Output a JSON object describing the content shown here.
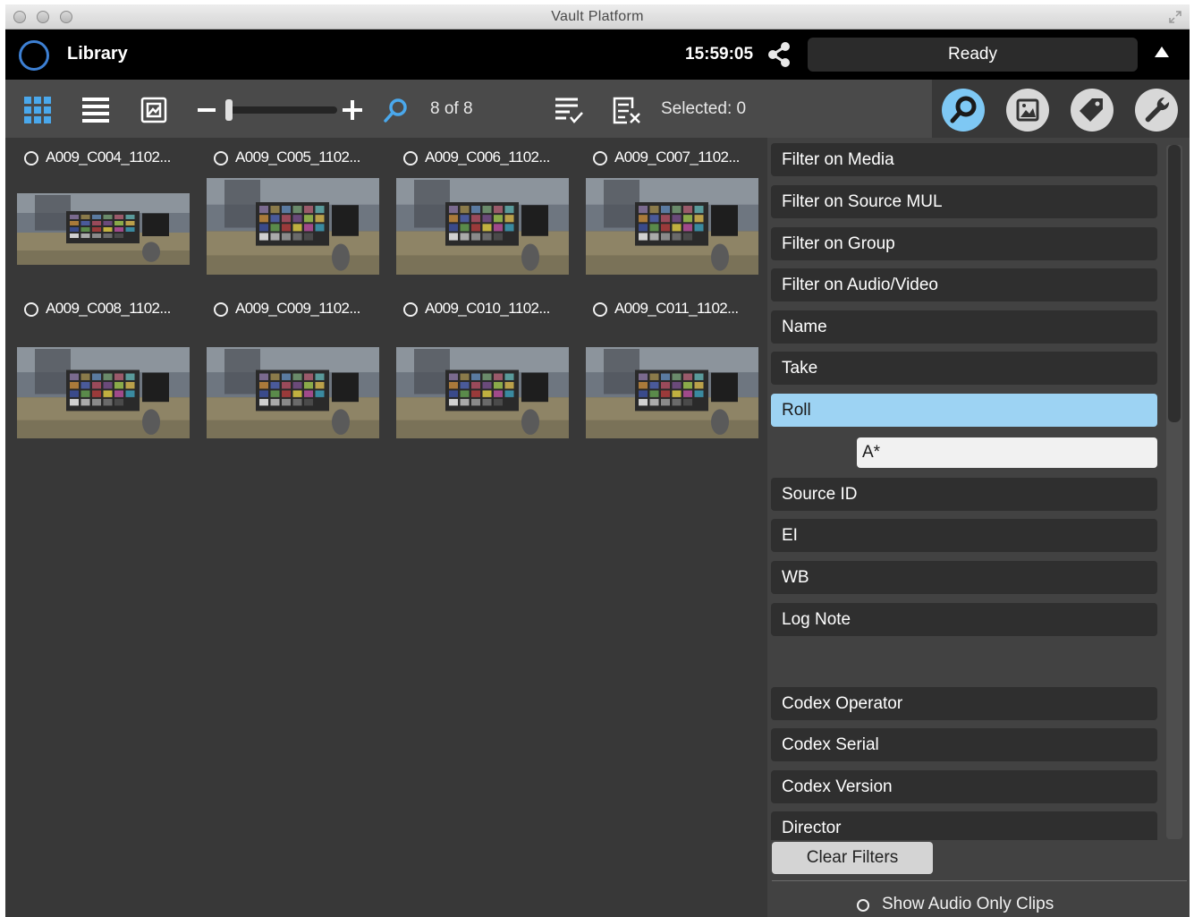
{
  "window": {
    "title": "Vault Platform"
  },
  "header": {
    "section_title": "Library",
    "clock": "15:59:05",
    "status": "Ready",
    "icons": [
      "ring-logo-icon",
      "share-icon",
      "triangle-up-icon"
    ]
  },
  "toolbar": {
    "icons": [
      "grid-view-icon",
      "list-view-icon",
      "frame-view-icon",
      "zoom-minus-icon",
      "zoom-plus-icon",
      "search-icon",
      "select-all-icon",
      "clear-selection-icon"
    ],
    "thumbnail_size_level": 0.05,
    "count_label": "8 of 8",
    "selected_label": "Selected: 0",
    "panel_buttons": [
      "search-icon",
      "image-icon",
      "tag-icon",
      "wrench-icon"
    ],
    "active_panel": "search"
  },
  "clips": [
    {
      "name": "A009_C004_1102..."
    },
    {
      "name": "A009_C005_1102..."
    },
    {
      "name": "A009_C006_1102..."
    },
    {
      "name": "A009_C007_1102..."
    },
    {
      "name": "A009_C008_1102..."
    },
    {
      "name": "A009_C009_1102..."
    },
    {
      "name": "A009_C010_1102..."
    },
    {
      "name": "A009_C011_1102..."
    }
  ],
  "filters": {
    "items": [
      {
        "label": "Filter on Media"
      },
      {
        "label": "Filter on Source MUL"
      },
      {
        "label": "Filter on Group"
      },
      {
        "label": "Filter on Audio/Video"
      },
      {
        "label": "Name"
      },
      {
        "label": "Take"
      },
      {
        "label": "Roll"
      },
      {
        "label": "Source ID"
      },
      {
        "label": "EI"
      },
      {
        "label": "WB"
      },
      {
        "label": "Log Note"
      },
      {
        "label": "Codex Operator"
      },
      {
        "label": "Codex Serial"
      },
      {
        "label": "Codex Version"
      },
      {
        "label": "Director"
      }
    ],
    "active_filter": "Roll",
    "roll_value": "A*",
    "clear_label": "Clear Filters",
    "audio_only_label": "Show Audio Only Clips"
  },
  "colors": {
    "accent": "#3d80d4",
    "active_filter": "#9dd3f3",
    "panel_bg": "#424242",
    "grid_bg": "#383838"
  }
}
